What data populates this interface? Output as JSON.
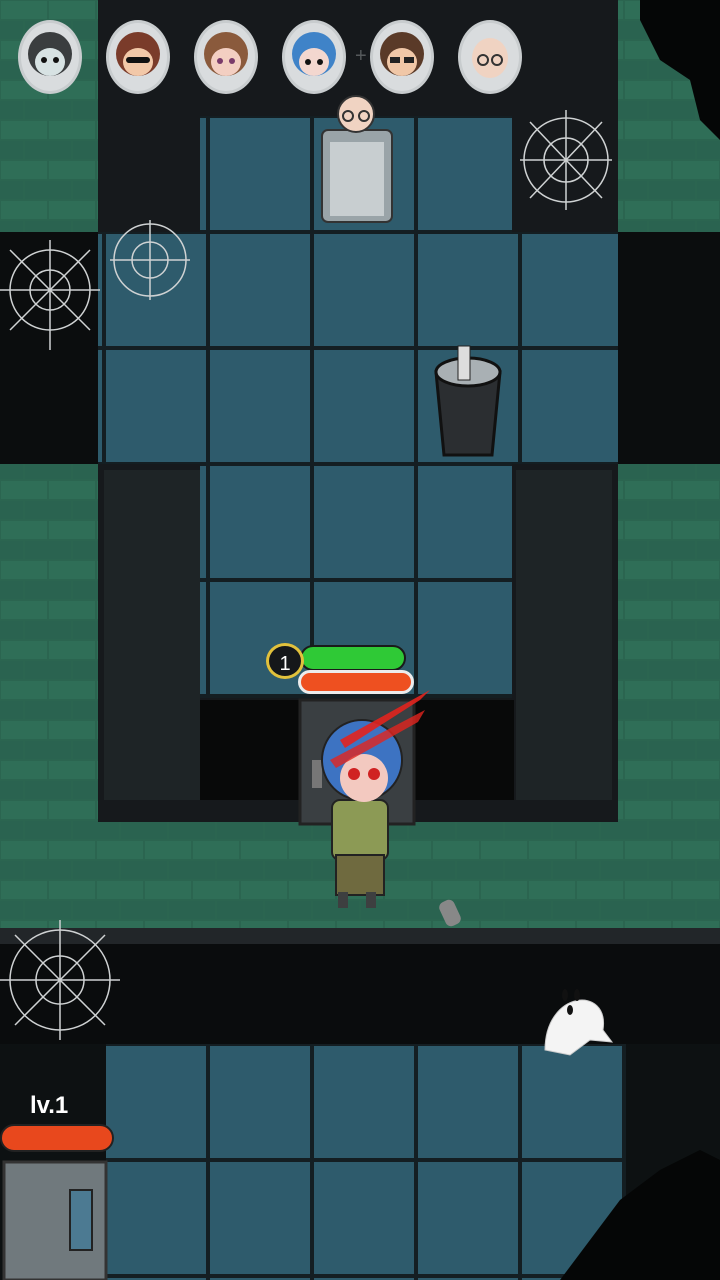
{
  "squad": {
    "avatars": [
      {
        "name": "masked-survivor-avatar",
        "hair": "#3a3d3f",
        "face": "#d7e2e3"
      },
      {
        "name": "sunglasses-survivor-avatar",
        "hair": "#7a3b2a",
        "face": "#f2c8a8"
      },
      {
        "name": "brown-hair-survivor-avatar",
        "hair": "#8a5a3c",
        "face": "#f3cfc2"
      },
      {
        "name": "blue-hair-survivor-avatar",
        "hair": "#3f83c8",
        "face": "#f3d7cf"
      },
      {
        "name": "glasses-survivor-avatar",
        "hair": "#5a3a28",
        "face": "#f0c7a7"
      },
      {
        "name": "bald-elder-avatar",
        "hair": "#d8d8d8",
        "face": "#f0d3c2"
      }
    ],
    "separator": "+"
  },
  "player": {
    "level": "1",
    "health_fraction": 1.0,
    "attack_fraction": 1.0
  },
  "door": {
    "level_label": "lv.1",
    "health_fraction": 1.0
  },
  "colors": {
    "floor_tile": "#2e5b6c",
    "brick_wall": "#2b6550",
    "health_green": "#2fc936",
    "health_orange": "#ee5020"
  }
}
